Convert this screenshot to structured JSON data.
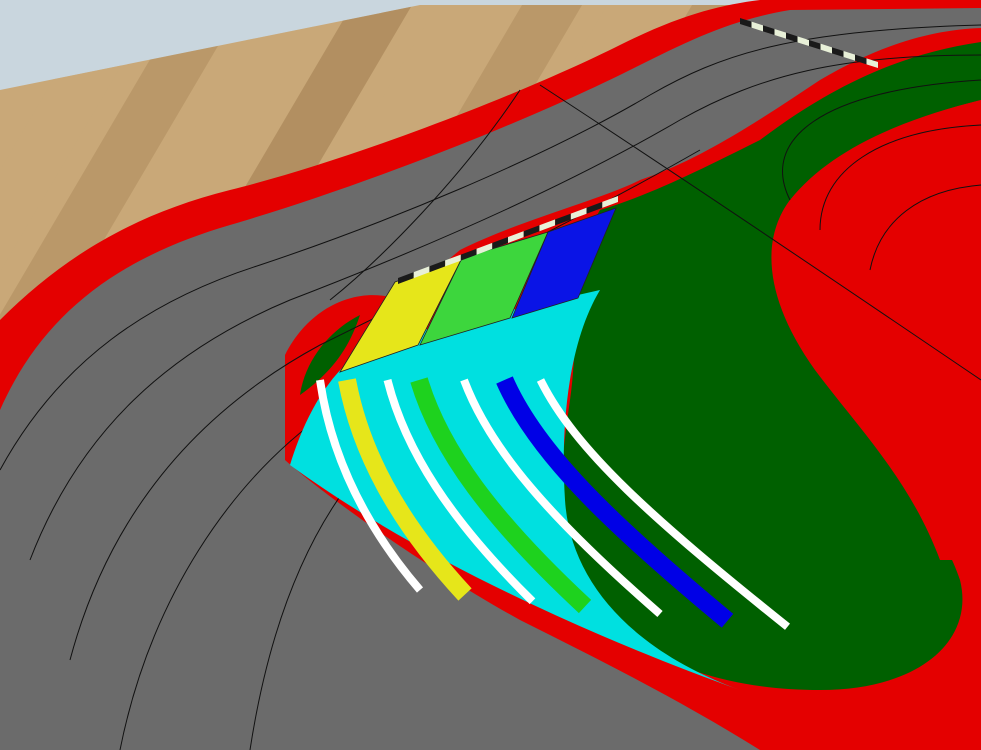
{
  "scene": {
    "type": "3d-slot-car-track-editor-viewport",
    "colors": {
      "sky": "#c9d6de",
      "floor_light": "#c9a878",
      "floor_dark": "#9e7a4e",
      "curb": "#e40000",
      "asphalt": "#6b6b6b",
      "lane_line": "#111111",
      "infield_grass": "#006000",
      "grid_yellow": "#e6e61a",
      "grid_green": "#3dd63d",
      "grid_blue": "#0a14e6",
      "lane_cyan": "#00e0e0",
      "lane_green": "#1ed21e",
      "lane_yellow": "#e6e61a",
      "lane_blue": "#0000e6",
      "stripe_white": "#ffffff",
      "stripe_grey": "#c8c8c8",
      "checker_dark": "#1a1a1a",
      "checker_light": "#e8f0d8"
    },
    "starting_grid": [
      "yellow",
      "green",
      "blue"
    ]
  }
}
